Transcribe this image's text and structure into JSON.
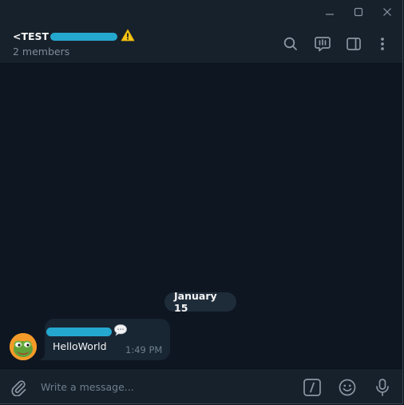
{
  "chat": {
    "title_prefix": "<TEST",
    "subtitle": "2 members"
  },
  "messages": {
    "date_label": "January 15",
    "items": [
      {
        "text": "HelloWorld",
        "time": "1:49 PM"
      }
    ]
  },
  "composer": {
    "placeholder": "Write a message..."
  },
  "icons": {
    "minimize": "minimize-icon",
    "maximize": "maximize-icon",
    "close": "close-icon",
    "warning": "warning-icon",
    "search": "search-icon",
    "comments": "comments-icon",
    "sidebar": "sidebar-toggle-icon",
    "more": "more-vertical-icon",
    "attach": "paperclip-icon",
    "commands": "slash-command-icon",
    "emoji": "emoji-icon",
    "mic": "microphone-icon",
    "badge": "speech-bubble-icon"
  },
  "colors": {
    "background": "#0e1621",
    "panel": "#17212b",
    "bubble": "#182533",
    "redaction": "#25a8d0",
    "avatar": "#f39a28"
  }
}
